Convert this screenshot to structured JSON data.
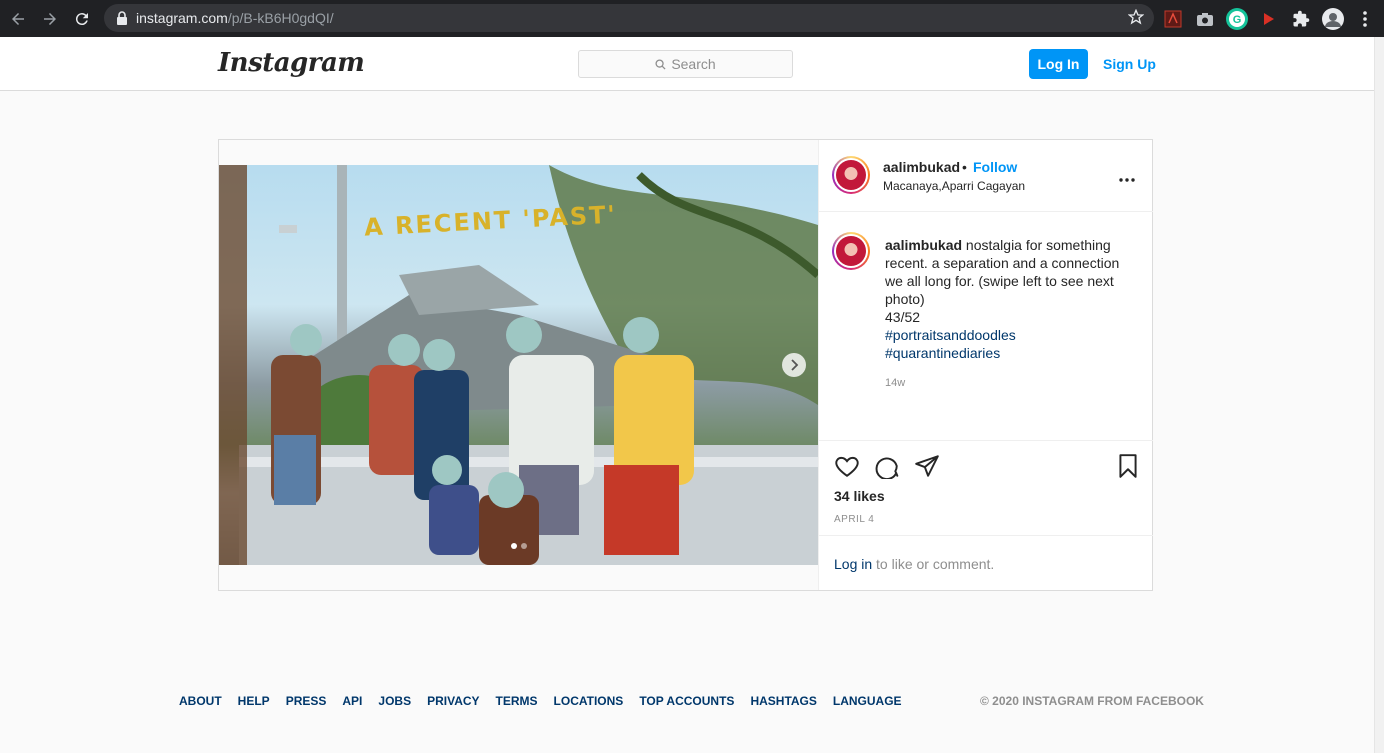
{
  "browser": {
    "url_host": "instagram.com",
    "url_path": "/p/B-kB6H0gdQI/"
  },
  "header": {
    "logo": "Instagram",
    "search_placeholder": "Search",
    "login_label": "Log In",
    "signup_label": "Sign Up"
  },
  "post": {
    "photo_text": "A RECENT 'PAST'",
    "username": "aalimbukad",
    "follow_label": "Follow",
    "location": "Macanaya,Aparri Cagayan",
    "caption": {
      "username": "aalimbukad",
      "text": "nostalgia for something recent. a separation and a connection we all long for. (swipe left to see next photo)",
      "count": "43/52",
      "tags": [
        "#portraitsanddoodles",
        "#quarantinediaries"
      ]
    },
    "time_ago": "14w",
    "likes": "34 likes",
    "date": "APRIL 4",
    "comment_prompt": {
      "link": "Log in",
      "rest": " to like or comment."
    }
  },
  "footer": {
    "links": [
      "ABOUT",
      "HELP",
      "PRESS",
      "API",
      "JOBS",
      "PRIVACY",
      "TERMS",
      "LOCATIONS",
      "TOP ACCOUNTS",
      "HASHTAGS",
      "LANGUAGE"
    ],
    "copyright": "© 2020 INSTAGRAM FROM FACEBOOK"
  }
}
